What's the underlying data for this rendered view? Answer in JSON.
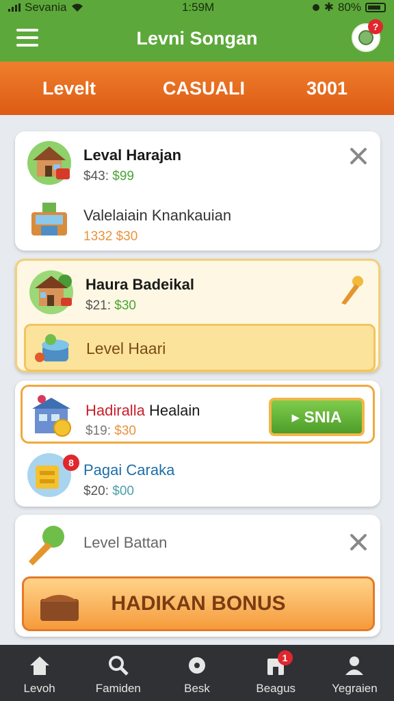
{
  "status_bar": {
    "carrier": "Sevania",
    "time": "1:59M",
    "battery": "80%"
  },
  "app_bar": {
    "title": "Levni Songan",
    "notification_count": "?"
  },
  "level_bar": {
    "left": "Levelt",
    "center": "CASUALI",
    "right": "3001"
  },
  "cards": [
    {
      "rows": [
        {
          "title": "Leval Harajan",
          "price_old": "$43:",
          "price_new": "$99"
        },
        {
          "title": "Valelaiain Knankauian",
          "price_old": "1332",
          "price_new": "$30"
        }
      ]
    },
    {
      "row": {
        "title": "Haura Badeikal",
        "price_old": "$21:",
        "price_new": "$30"
      },
      "sub_label": "Level Haari"
    },
    {
      "rows": [
        {
          "title_part1": "Hadiralla",
          "title_part2": " Healain",
          "price_old": "$19:",
          "price_new": "$30",
          "button": "▸ SNIA"
        },
        {
          "title": "Pagai Caraka",
          "price_old": "$20:",
          "price_new": "$00",
          "badge": "8"
        }
      ]
    },
    {
      "row": {
        "title": "Level Battan"
      },
      "button": "HADIKAN BONUS"
    }
  ],
  "tab_bar": {
    "items": [
      {
        "label": "Levoh",
        "icon": "home-icon"
      },
      {
        "label": "Famiden",
        "icon": "search-icon"
      },
      {
        "label": "Besk",
        "icon": "gear-icon"
      },
      {
        "label": "Beagus",
        "icon": "store-icon",
        "badge": "1"
      },
      {
        "label": "Yegraien",
        "icon": "user-icon"
      }
    ]
  },
  "colors": {
    "green": "#5da83a",
    "orange": "#e8691f",
    "dark": "#2f3135",
    "badge_red": "#e1262d"
  }
}
